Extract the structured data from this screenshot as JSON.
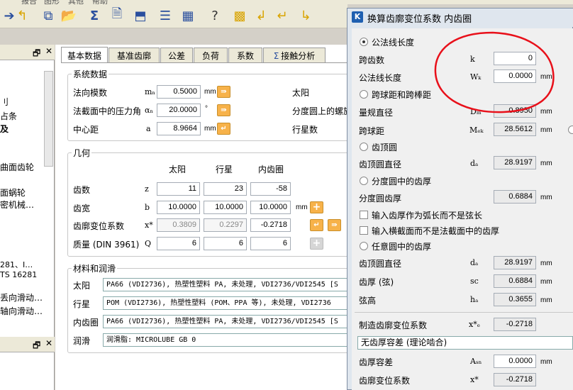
{
  "menu": [
    "报告",
    "图形",
    "其他",
    "帮助"
  ],
  "toolbar_icons": [
    "arrow-right-icon",
    "arrow-back-icon",
    "copy-icon",
    "open-folder-icon",
    "sum-icon",
    "document-icon",
    "save-icon",
    "list-icon",
    "calculator-icon",
    "help-icon",
    "pattern-icon",
    "arrow-left-icon",
    "arrow-down-icon"
  ],
  "left_panel": {
    "pin": "🗗",
    "close": "✕",
    "lines": [
      "刂",
      "占条",
      "及",
      "曲面齿轮",
      "面蜗轮",
      "密机械…",
      "281、I…",
      "TS 16281",
      "丢向滑动…",
      "轴向滑动…"
    ],
    "bold_index": 2
  },
  "left_panel2": {
    "pin": "🗗",
    "close": "✕"
  },
  "tabs": [
    "基本数据",
    "基准齿廓",
    "公差",
    "负荷",
    "系数",
    "接触分析"
  ],
  "active_tab": 0,
  "system": {
    "title": "系统数据",
    "rows": [
      {
        "label": "法向模数",
        "sym": "mₙ",
        "value": "0.5000",
        "unit": "mm",
        "right": "太阳"
      },
      {
        "label": "法截面中的压力角",
        "sym": "αₙ",
        "value": "20.0000",
        "unit": "°",
        "right": "分度圆上的螺旋"
      },
      {
        "label": "中心距",
        "sym": "a",
        "value": "8.9664",
        "unit": "mm",
        "right": "行星数"
      }
    ]
  },
  "geometry": {
    "title": "几何",
    "cols": [
      "太阳",
      "行星",
      "内齿圈"
    ],
    "rows": [
      {
        "label": "齿数",
        "sym": "z",
        "values": [
          "11",
          "23",
          "-58"
        ],
        "unit": ""
      },
      {
        "label": "齿宽",
        "sym": "b",
        "values": [
          "10.0000",
          "10.0000",
          "10.0000"
        ],
        "unit": "mm"
      },
      {
        "label": "齿廓变位系数",
        "sym": "x*",
        "values": [
          "0.3809",
          "0.2297",
          "-0.2718"
        ],
        "unit": ""
      },
      {
        "label": "质量 (DIN 3961)",
        "sym": "Q",
        "values": [
          "6",
          "6",
          "6"
        ],
        "unit": ""
      }
    ]
  },
  "materials": {
    "title": "材料和润滑",
    "rows": [
      {
        "label": "太阳",
        "value": "PA66 (VDI2736), 热塑性塑料 PA, 未处理, VDI2736/VDI2545 [S"
      },
      {
        "label": "行星",
        "value": "POM (VDI2736), 热塑性塑料 (POM、PPA 等), 未处理, VDI2736"
      },
      {
        "label": "内齿圈",
        "value": "PA66 (VDI2736), 热塑性塑料 PA, 未处理, VDI2736/VDI2545 [S"
      },
      {
        "label": "润滑",
        "value": "润滑脂: MICROLUBE GB 0"
      }
    ]
  },
  "dialog": {
    "title": "换算齿廓变位系数 内齿圈",
    "logo": "K",
    "sections": [
      {
        "type": "radio",
        "label": "公法线长度",
        "on": true
      },
      {
        "type": "field",
        "label": "跨齿数",
        "sym": "k",
        "value": "0",
        "unit": ""
      },
      {
        "type": "field",
        "label": "公法线长度",
        "sym": "Wₖ",
        "value": "0.0000",
        "unit": "mm"
      },
      {
        "type": "radio",
        "label": "跨球距和跨棒距",
        "on": false
      },
      {
        "type": "field",
        "label": "量规直径",
        "sym": "Dₘ",
        "value": "0.8950",
        "unit": "mm",
        "ro": true
      },
      {
        "type": "field",
        "label": "跨球距",
        "sym": "Mₑₖ",
        "value": "28.5612",
        "unit": "mm",
        "ro": true
      },
      {
        "type": "radio",
        "label": "齿顶圆",
        "on": false
      },
      {
        "type": "field",
        "label": "齿顶圆直径",
        "sym": "dₐ",
        "value": "28.9197",
        "unit": "mm",
        "ro": true
      },
      {
        "type": "radio",
        "label": "分度圆中的齿厚",
        "on": false
      },
      {
        "type": "field",
        "label": "分度圆齿厚",
        "sym": "",
        "value": "0.6884",
        "unit": "mm",
        "ro": true
      },
      {
        "type": "check",
        "label": "输入齿厚作为弧长而不是弦长"
      },
      {
        "type": "check",
        "label": "输入横截面而不是法截面中的齿厚"
      },
      {
        "type": "radio",
        "label": "任意圆中的齿厚",
        "on": false
      },
      {
        "type": "field",
        "label": "齿顶圆直径",
        "sym": "dₐ",
        "value": "28.9197",
        "unit": "mm",
        "ro": true
      },
      {
        "type": "field",
        "label": "齿厚 (弦)",
        "sym": "sc",
        "value": "0.6884",
        "unit": "mm",
        "ro": true
      },
      {
        "type": "field",
        "label": "弦高",
        "sym": "hₐ",
        "value": "0.3655",
        "unit": "mm",
        "ro": true
      },
      {
        "type": "field",
        "label": "制造齿廓变位系数",
        "sym": "x*ₑ",
        "value": "-0.2718",
        "unit": "",
        "ro": true
      },
      {
        "type": "combo",
        "label": "无齿厚容差 (理论啮合)"
      },
      {
        "type": "field",
        "label": "齿厚容差",
        "sym": "Aₛₙ",
        "value": "0.0000",
        "unit": "mm"
      },
      {
        "type": "field",
        "label": "齿廓变位系数",
        "sym": "x*",
        "value": "-0.2718",
        "unit": "",
        "ro": true
      }
    ]
  },
  "annotation_color": "#e8101a"
}
